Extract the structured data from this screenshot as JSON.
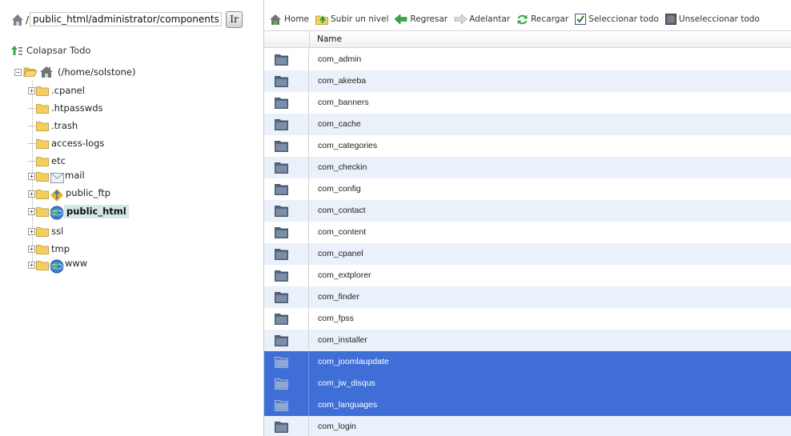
{
  "address_bar": {
    "slash": "/",
    "path": "public_html/administrator/components",
    "go_label": "Ir"
  },
  "tree": {
    "collapse_label": "Colapsar Todo",
    "root_label": "(/home/solstone)",
    "items": [
      {
        "label": ".cpanel",
        "expander": true
      },
      {
        "label": ".htpasswds",
        "expander": false
      },
      {
        "label": ".trash",
        "expander": false
      },
      {
        "label": "access-logs",
        "expander": false
      },
      {
        "label": "etc",
        "expander": false
      },
      {
        "label": "mail",
        "expander": true,
        "icon": "mail-icon"
      },
      {
        "label": "public_ftp",
        "expander": true,
        "icon": "ftp-icon"
      },
      {
        "label": "public_html",
        "expander": true,
        "icon": "globe-icon",
        "selected": true
      },
      {
        "label": "ssl",
        "expander": true
      },
      {
        "label": "tmp",
        "expander": true
      },
      {
        "label": "www",
        "expander": true,
        "icon": "globe-icon"
      }
    ]
  },
  "toolbar": {
    "home": "Home",
    "up": "Subir un nivel",
    "back": "Regresar",
    "forward": "Adelantar",
    "reload": "Recargar",
    "select_all": "Seleccionar todo",
    "unselect_all": "Unseleccionar todo"
  },
  "table": {
    "header_name": "Name",
    "rows": [
      {
        "name": "com_admin",
        "selected": false
      },
      {
        "name": "com_akeeba",
        "selected": false
      },
      {
        "name": "com_banners",
        "selected": false
      },
      {
        "name": "com_cache",
        "selected": false
      },
      {
        "name": "com_categories",
        "selected": false
      },
      {
        "name": "com_checkin",
        "selected": false
      },
      {
        "name": "com_config",
        "selected": false
      },
      {
        "name": "com_contact",
        "selected": false
      },
      {
        "name": "com_content",
        "selected": false
      },
      {
        "name": "com_cpanel",
        "selected": false
      },
      {
        "name": "com_extplorer",
        "selected": false
      },
      {
        "name": "com_finder",
        "selected": false
      },
      {
        "name": "com_fpss",
        "selected": false
      },
      {
        "name": "com_installer",
        "selected": false
      },
      {
        "name": "com_joomlaupdate",
        "selected": true
      },
      {
        "name": "com_jw_disqus",
        "selected": true
      },
      {
        "name": "com_languages",
        "selected": true
      },
      {
        "name": "com_login",
        "selected": false
      }
    ]
  },
  "colors": {
    "selection": "#3f6fd6",
    "row_alt": "#eaf1fa",
    "tree_selected": "#d4e8e8"
  }
}
